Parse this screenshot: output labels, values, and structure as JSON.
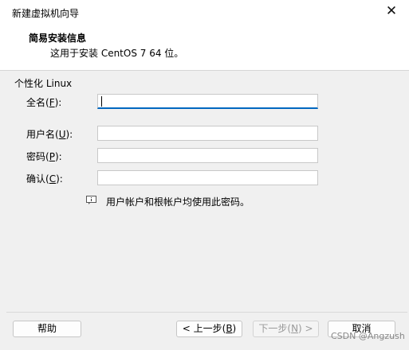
{
  "window": {
    "title": "新建虚拟机向导",
    "close_glyph": "✕"
  },
  "header": {
    "title": "简易安装信息",
    "subtitle": "这用于安装 CentOS 7 64 位。"
  },
  "group": {
    "label": "个性化 Linux"
  },
  "fields": {
    "fullname": {
      "label": "全名(",
      "mnemonic": "F",
      "suffix": "):",
      "value": ""
    },
    "username": {
      "label": "用户名(",
      "mnemonic": "U",
      "suffix": "):",
      "value": ""
    },
    "password": {
      "label": "密码(",
      "mnemonic": "P",
      "suffix": "):",
      "value": ""
    },
    "confirm": {
      "label": "确认(",
      "mnemonic": "C",
      "suffix": "):",
      "value": ""
    }
  },
  "info": {
    "icon": "info-icon",
    "text": "用户帐户和根帐户均使用此密码。"
  },
  "buttons": {
    "help": "帮助",
    "back_prefix": "< 上一步(",
    "back_mnemonic": "B",
    "back_suffix": ")",
    "next_prefix": "下一步(",
    "next_mnemonic": "N",
    "next_suffix": ") >",
    "cancel": "取消"
  },
  "watermark": "CSDN @Angzush",
  "colors": {
    "focus_accent": "#0067c0",
    "disabled_text": "#9a9a9a"
  }
}
